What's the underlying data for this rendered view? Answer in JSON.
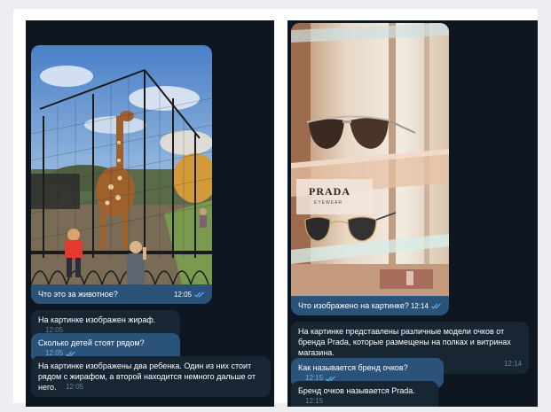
{
  "colors": {
    "chat_bg": "#0e1621",
    "outgoing_bubble": "#2b5278",
    "incoming_bubble": "#182533",
    "read_check": "#5eb5f7"
  },
  "left_chat": {
    "photo_message": {
      "caption": "Что это за животное?",
      "time": "12:05",
      "status": "read",
      "photo_subject": "giraffe-zoo-photo"
    },
    "messages": [
      {
        "direction": "in",
        "text": "На картинке изображен жираф.",
        "time": "12:05"
      },
      {
        "direction": "out",
        "text": "Сколько детей стоят рядом?",
        "time": "12:05",
        "status": "read"
      },
      {
        "direction": "in",
        "text": "На картинке изображены два ребенка. Один из них стоит рядом с жирафом, а второй находится немного дальше от него.",
        "time": "12:05"
      }
    ]
  },
  "right_chat": {
    "photo_message": {
      "caption": "Что изображено на картинке?",
      "time": "12:14",
      "status": "read",
      "photo_subject": "sunglasses-store-photo",
      "brand_sign": "PRADA",
      "brand_sign_sub": "EYEWEAR"
    },
    "messages": [
      {
        "direction": "in",
        "text": "На картинке представлены различные модели очков от бренда Prada, которые размещены на полках и витринах магазина.",
        "time": "12:14"
      },
      {
        "direction": "out",
        "text": "Как называется бренд очков?",
        "time": "12:15",
        "status": "read"
      },
      {
        "direction": "in",
        "text": "Бренд очков называется Prada.",
        "time": "12:15"
      }
    ]
  }
}
